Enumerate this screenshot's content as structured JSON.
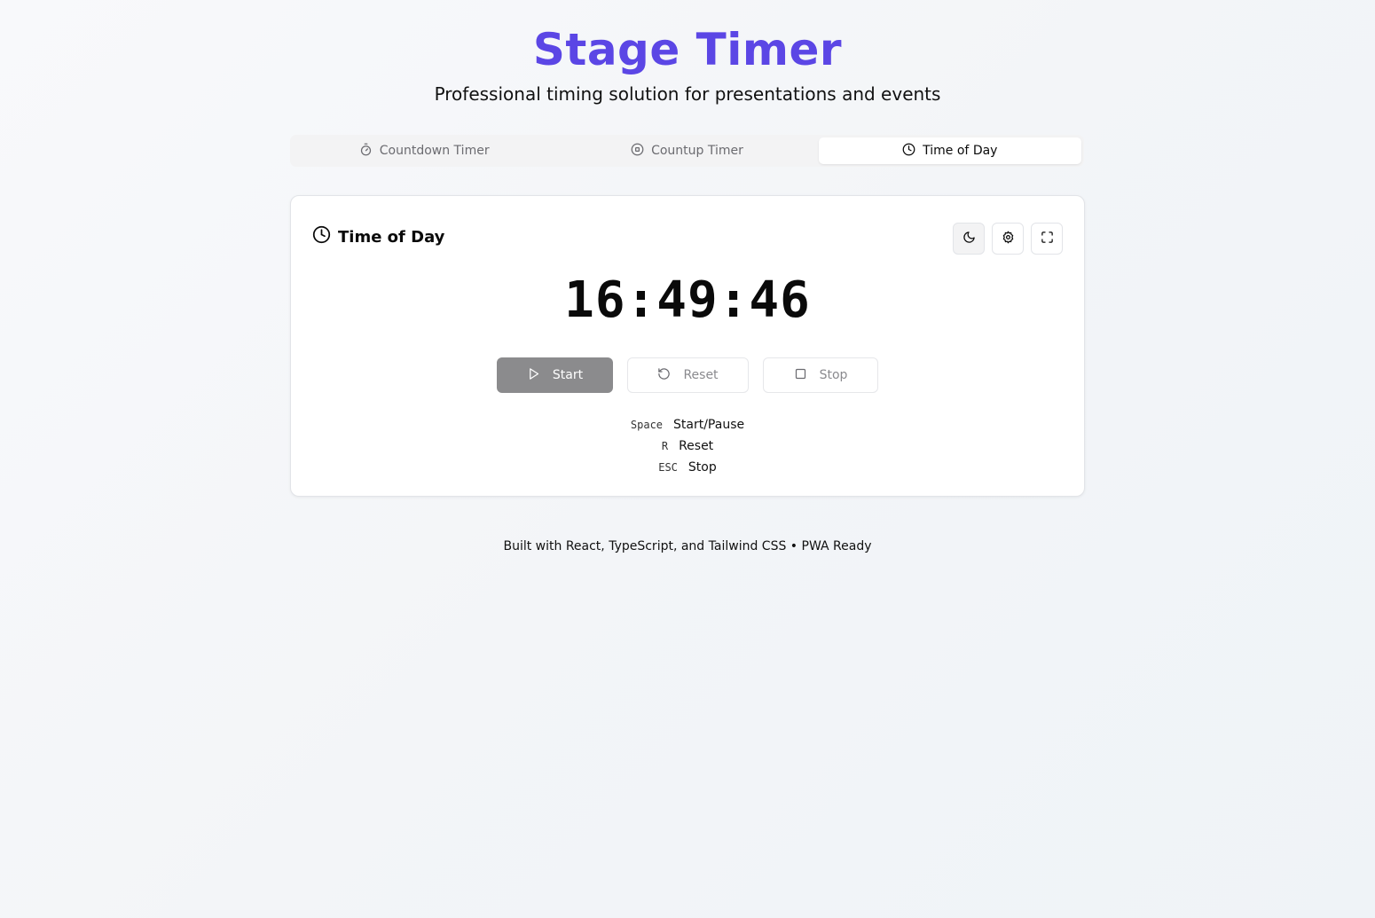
{
  "app": {
    "title": "Stage Timer",
    "subtitle": "Professional timing solution for presentations and events"
  },
  "tabs": [
    {
      "label": "Countdown Timer",
      "icon": "stopwatch-icon",
      "active": false
    },
    {
      "label": "Countup Timer",
      "icon": "record-circle-icon",
      "active": false
    },
    {
      "label": "Time of Day",
      "icon": "clock-icon",
      "active": true
    }
  ],
  "card": {
    "title": "Time of Day",
    "time": "16:49:46",
    "icon_buttons": [
      "moon-icon",
      "gear-icon",
      "fullscreen-icon"
    ],
    "controls": {
      "start": "Start",
      "reset": "Reset",
      "stop": "Stop"
    },
    "shortcuts": [
      {
        "key": "Space",
        "action": "Start/Pause"
      },
      {
        "key": "R",
        "action": "Reset"
      },
      {
        "key": "ESC",
        "action": "Stop"
      }
    ]
  },
  "footer": "Built with React, TypeScript, and Tailwind CSS • PWA Ready",
  "colors": {
    "accent": "#5b46e5",
    "start_button": "#8b8b8d"
  }
}
